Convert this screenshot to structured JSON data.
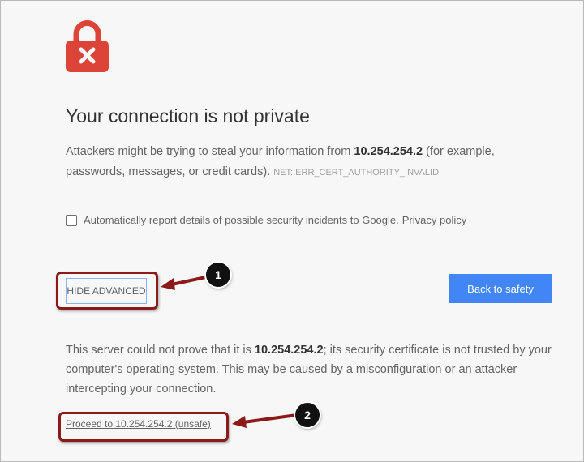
{
  "page": {
    "title": "Your connection is not private",
    "description_prefix": "Attackers might be trying to steal your information from ",
    "host": "10.254.254.2",
    "description_suffix": " (for example, passwords, messages, or credit cards).",
    "error_code": "NET::ERR_CERT_AUTHORITY_INVALID"
  },
  "report": {
    "checkbox_label": "Automatically report details of possible security incidents to Google.",
    "privacy_link": "Privacy policy"
  },
  "buttons": {
    "hide_advanced": "HIDE ADVANCED",
    "back_to_safety": "Back to safety"
  },
  "details": {
    "prefix": "This server could not prove that it is ",
    "host": "10.254.254.2",
    "suffix": "; its security certificate is not trusted by your computer's operating system. This may be caused by a misconfiguration or an attacker intercepting your connection.",
    "proceed_link": "Proceed to 10.254.254.2 (unsafe)"
  },
  "callouts": [
    "1",
    "2"
  ],
  "colors": {
    "lock_red": "#db4437",
    "button_blue": "#4285f4",
    "callout_border": "#8b1a1a",
    "background": "#f7f7f7"
  },
  "icons": {
    "lock": "lock-error-icon",
    "arrow": "annotation-arrow-icon"
  }
}
